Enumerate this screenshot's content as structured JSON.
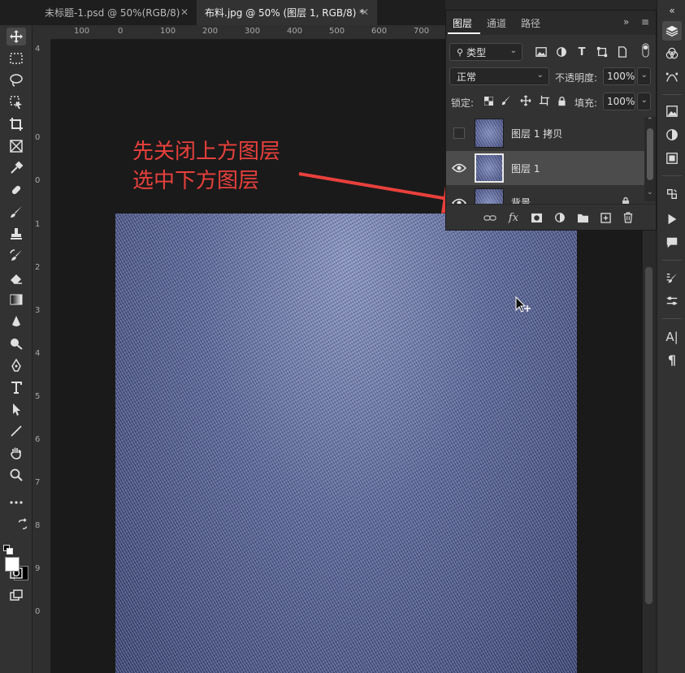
{
  "tabs": [
    {
      "label": "未标题-1.psd @ 50%(RGB/8)",
      "active": false
    },
    {
      "label": "布料.jpg @ 50% (图层 1, RGB/8) *",
      "active": true
    }
  ],
  "close_glyph": "✕",
  "ruler": {
    "top": [
      "100",
      "0",
      "100",
      "200",
      "300",
      "400",
      "500",
      "600",
      "700"
    ],
    "left": [
      "4",
      "0",
      "0",
      "1",
      "2",
      "3",
      "4",
      "5",
      "6",
      "7",
      "8",
      "9",
      "0"
    ]
  },
  "annotation": {
    "line1": "先关闭上方图层",
    "line2": "选中下方图层",
    "color": "#e8403c"
  },
  "layers_panel": {
    "tabs": [
      "图层",
      "通道",
      "路径"
    ],
    "collapse": "»",
    "menu": "≡",
    "filter_label": "类型",
    "blend_mode": "正常",
    "opacity_label": "不透明度:",
    "opacity_value": "100%",
    "lock_label": "锁定:",
    "fill_label": "填充:",
    "fill_value": "100%",
    "layers": [
      {
        "name": "图层 1 拷贝",
        "visible": false,
        "selected": false
      },
      {
        "name": "图层 1",
        "visible": true,
        "selected": true
      },
      {
        "name": "背景",
        "visible": true,
        "selected": false
      }
    ]
  },
  "icons": {
    "tools": [
      "move-icon",
      "marquee-icon",
      "lasso-icon",
      "object-select-icon",
      "crop-icon",
      "frame-icon",
      "eyedropper-icon",
      "healing-icon",
      "brush-icon",
      "stamp-icon",
      "history-brush-icon",
      "eraser-icon",
      "gradient-icon",
      "blur-icon",
      "dodge-icon",
      "pen-icon",
      "type-icon",
      "path-select-icon",
      "line-icon",
      "hand-icon",
      "zoom-icon",
      "more-icon"
    ],
    "right_strip": [
      "layers-icon",
      "channels-icon",
      "paths-icon",
      "libraries-icon",
      "adjustments-icon",
      "properties-icon",
      "history-icon",
      "actions-icon",
      "comments-icon",
      "brushes-icon",
      "tool-presets-icon",
      "character-icon",
      "paragraph-icon"
    ]
  }
}
